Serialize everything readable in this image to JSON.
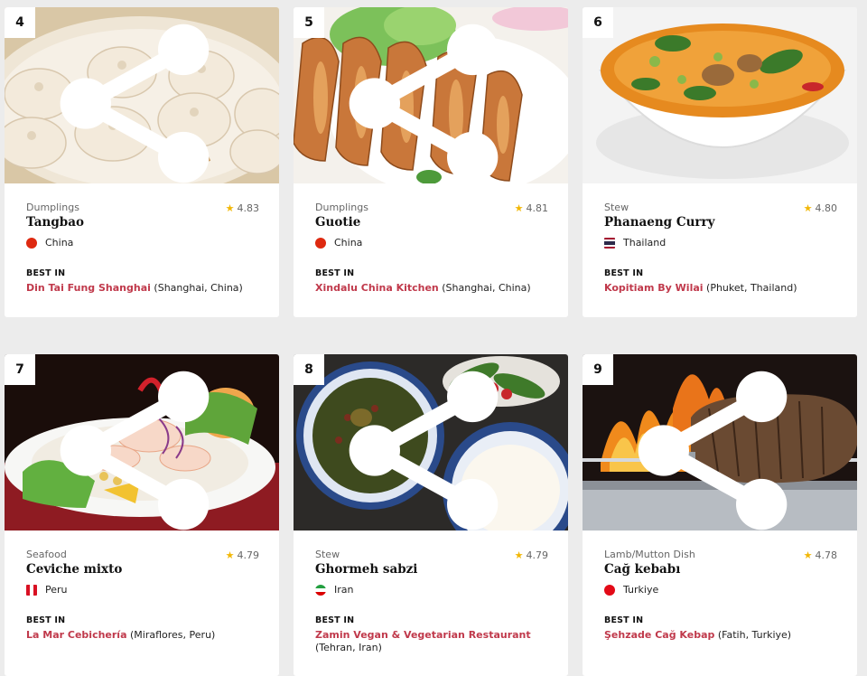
{
  "cards": [
    {
      "rank": "4",
      "category": "Dumplings",
      "rating": "4.83",
      "name": "Tangbao",
      "country": "China",
      "best_label": "BEST IN",
      "restaurant": "Din Tai Fung Shanghai",
      "location": "(Shanghai, China)",
      "flag": "china",
      "icon": "share-icon",
      "image": "xiaolongbao dumplings in steamer"
    },
    {
      "rank": "5",
      "category": "Dumplings",
      "rating": "4.81",
      "name": "Guotie",
      "country": "China",
      "best_label": "BEST IN",
      "restaurant": "Xindalu China Kitchen",
      "location": "(Shanghai, China)",
      "flag": "china",
      "icon": "share-icon",
      "image": "pan-fried potstickers"
    },
    {
      "rank": "6",
      "category": "Stew",
      "rating": "4.80",
      "name": "Phanaeng Curry",
      "country": "Thailand",
      "best_label": "BEST IN",
      "restaurant": "Kopitiam By Wilai",
      "location": "(Phuket, Thailand)",
      "flag": "thailand",
      "icon": "share-icon",
      "image": "curry in white bowl"
    },
    {
      "rank": "7",
      "category": "Seafood",
      "rating": "4.79",
      "name": "Ceviche mixto",
      "country": "Peru",
      "best_label": "BEST IN",
      "restaurant": "La Mar Cebichería",
      "location": "(Miraflores, Peru)",
      "flag": "peru",
      "icon": "share-icon",
      "image": "ceviche plate"
    },
    {
      "rank": "8",
      "category": "Stew",
      "rating": "4.79",
      "name": "Ghormeh sabzi",
      "country": "Iran",
      "best_label": "BEST IN",
      "restaurant": "Zamin Vegan & Vegetarian Restaurant",
      "location": "(Tehran, Iran)",
      "flag": "iran",
      "icon": "share-icon",
      "image": "herb stew with rice"
    },
    {
      "rank": "9",
      "category": "Lamb/Mutton Dish",
      "rating": "4.78",
      "name": "Cağ kebabı",
      "country": "Turkiye",
      "best_label": "BEST IN",
      "restaurant": "Şehzade Cağ Kebap",
      "location": "(Fatih, Turkiye)",
      "flag": "turkey",
      "icon": "share-icon",
      "image": "horizontal kebab over fire"
    }
  ],
  "colors": {
    "link": "#c0394b",
    "star": "#f2b705",
    "background": "#ececec"
  }
}
